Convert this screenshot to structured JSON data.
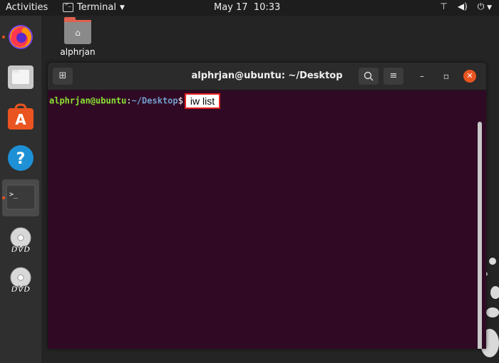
{
  "topbar": {
    "activities": "Activities",
    "app_name": "Terminal",
    "date": "May 17",
    "time": "10:33"
  },
  "dock": {
    "items": [
      "firefox-icon",
      "files-icon",
      "software-icon",
      "help-icon",
      "terminal-icon",
      "dvd-icon",
      "dvd-icon"
    ],
    "dvd_label": "DVD"
  },
  "desktop": {
    "home_folder_label": "alphrjan"
  },
  "terminal": {
    "title": "alphrjan@ubuntu: ~/Desktop",
    "prompt_user": "alphrjan@ubuntu",
    "prompt_sep": ":",
    "prompt_path": "~/Desktop",
    "prompt_symbol": "$",
    "command": "iw list"
  },
  "colors": {
    "terminal_bg": "#300a24",
    "prompt_user": "#8ae234",
    "prompt_path": "#729fcf",
    "accent": "#e95420",
    "highlight_border": "#e02020"
  }
}
